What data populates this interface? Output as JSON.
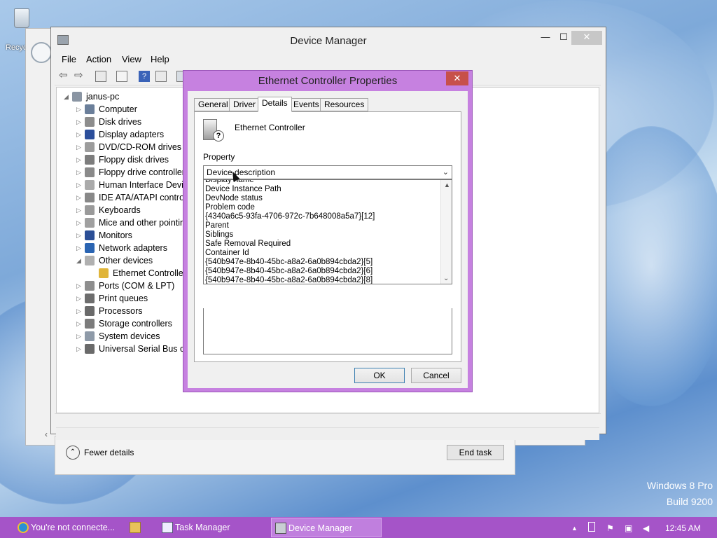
{
  "desktop": {
    "recycle_bin_label": "Recyc",
    "watermark_line1": "Windows 8 Pro",
    "watermark_line2": "Build 9200"
  },
  "task_manager": {
    "fewer_details": "Fewer details",
    "end_task": "End task"
  },
  "device_manager": {
    "title": "Device Manager",
    "minimize": "—",
    "maximize": "☐",
    "close": "✕",
    "menu": [
      "File",
      "Action",
      "View",
      "Help"
    ],
    "tree": [
      {
        "label": "janus-pc",
        "arrow": "◢",
        "icon": "computer-icon"
      },
      {
        "label": "Computer",
        "arrow": "▷",
        "icon": "computer-icon"
      },
      {
        "label": "Disk drives",
        "arrow": "▷",
        "icon": "disk-drive-icon"
      },
      {
        "label": "Display adapters",
        "arrow": "▷",
        "icon": "display-adapter-icon"
      },
      {
        "label": "DVD/CD-ROM drives",
        "arrow": "▷",
        "icon": "dvd-drive-icon"
      },
      {
        "label": "Floppy disk drives",
        "arrow": "▷",
        "icon": "floppy-disk-icon"
      },
      {
        "label": "Floppy drive controller",
        "arrow": "▷",
        "icon": "floppy-controller-icon"
      },
      {
        "label": "Human Interface Devic",
        "arrow": "▷",
        "icon": "hid-icon"
      },
      {
        "label": "IDE ATA/ATAPI contro",
        "arrow": "▷",
        "icon": "ide-controller-icon"
      },
      {
        "label": "Keyboards",
        "arrow": "▷",
        "icon": "keyboard-icon"
      },
      {
        "label": "Mice and other pointin",
        "arrow": "▷",
        "icon": "mouse-icon"
      },
      {
        "label": "Monitors",
        "arrow": "▷",
        "icon": "monitor-icon"
      },
      {
        "label": "Network adapters",
        "arrow": "▷",
        "icon": "network-adapter-icon"
      },
      {
        "label": "Other devices",
        "arrow": "◢",
        "icon": "other-devices-icon"
      },
      {
        "label": "Ethernet Controller",
        "arrow": "",
        "icon": "warning-device-icon"
      },
      {
        "label": "Ports (COM & LPT)",
        "arrow": "▷",
        "icon": "port-icon"
      },
      {
        "label": "Print queues",
        "arrow": "▷",
        "icon": "printer-icon"
      },
      {
        "label": "Processors",
        "arrow": "▷",
        "icon": "processor-icon"
      },
      {
        "label": "Storage controllers",
        "arrow": "▷",
        "icon": "storage-controller-icon"
      },
      {
        "label": "System devices",
        "arrow": "▷",
        "icon": "system-devices-icon"
      },
      {
        "label": "Universal Serial Bus co",
        "arrow": "▷",
        "icon": "usb-icon"
      }
    ]
  },
  "dialog": {
    "title": "Ethernet Controller Properties",
    "close": "✕",
    "tabs": [
      "General",
      "Driver",
      "Details",
      "Events",
      "Resources"
    ],
    "active_tab": "Details",
    "device_name": "Ethernet Controller",
    "property_label": "Property",
    "property_selected": "Device description",
    "dropdown_options": [
      "Display name",
      "Device Instance Path",
      "DevNode status",
      "Problem code",
      "{4340a6c5-93fa-4706-972c-7b648008a5a7}[12]",
      "Parent",
      "Siblings",
      "Safe Removal Required",
      "Container Id",
      "{540b947e-8b40-45bc-a8a2-6a0b894cbda2}[5]",
      "{540b947e-8b40-45bc-a8a2-6a0b894cbda2}[6]",
      "{540b947e-8b40-45bc-a8a2-6a0b894cbda2}[8]"
    ],
    "ok": "OK",
    "cancel": "Cancel"
  },
  "taskbar": {
    "items": [
      {
        "label": "You're not connecte...",
        "icon": "internet-explorer-icon",
        "active": false
      },
      {
        "label": "",
        "icon": "file-explorer-icon",
        "active": false
      },
      {
        "label": "Task Manager",
        "icon": "task-manager-icon",
        "active": false
      },
      {
        "label": "Device Manager",
        "icon": "device-manager-icon",
        "active": true
      }
    ],
    "clock": "12:45 AM"
  },
  "colors": {
    "taskbar": "#a554c8",
    "dialog_frame": "#c681e0",
    "close_red": "#c7504a"
  }
}
